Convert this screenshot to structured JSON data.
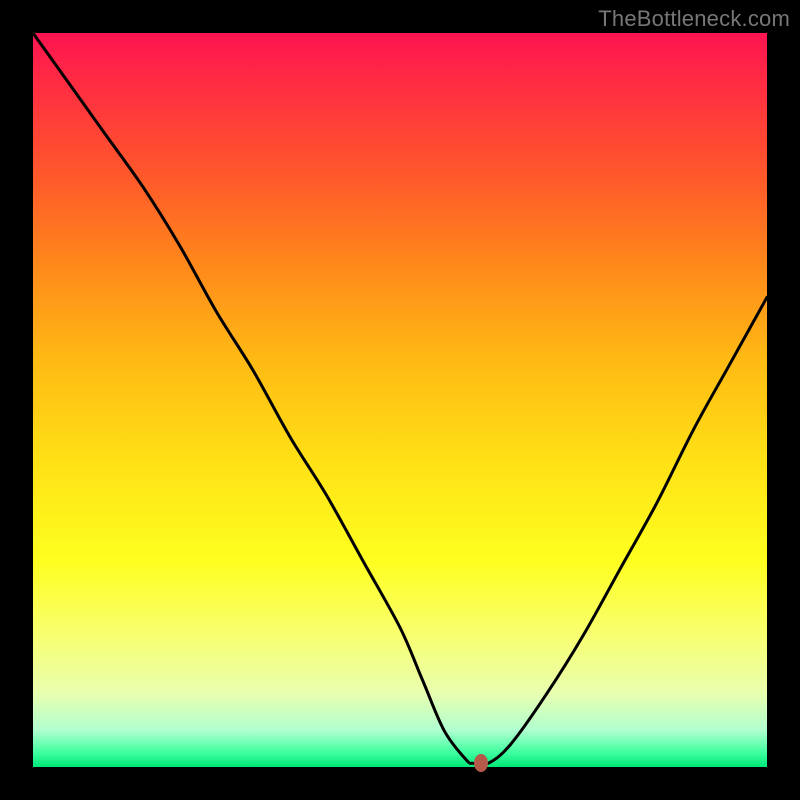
{
  "watermark": "TheBottleneck.com",
  "chart_data": {
    "type": "line",
    "title": "",
    "xlabel": "",
    "ylabel": "",
    "xlim": [
      0,
      100
    ],
    "ylim": [
      0,
      100
    ],
    "grid": false,
    "legend": false,
    "series": [
      {
        "name": "bottleneck-curve",
        "x": [
          0,
          5,
          10,
          15,
          20,
          25,
          30,
          35,
          40,
          45,
          50,
          53,
          56,
          59,
          60,
          62,
          65,
          70,
          75,
          80,
          85,
          90,
          95,
          100
        ],
        "y": [
          100,
          93,
          86,
          79,
          71,
          62,
          54,
          45,
          37,
          28,
          19,
          12,
          5,
          1,
          0.5,
          0.5,
          3,
          10,
          18,
          27,
          36,
          46,
          55,
          64
        ]
      }
    ],
    "marker": {
      "x": 61,
      "y": 0.5,
      "color": "#b35a4a"
    },
    "background_gradient": {
      "top": "#ff1452",
      "bottom": "#00e878"
    }
  }
}
